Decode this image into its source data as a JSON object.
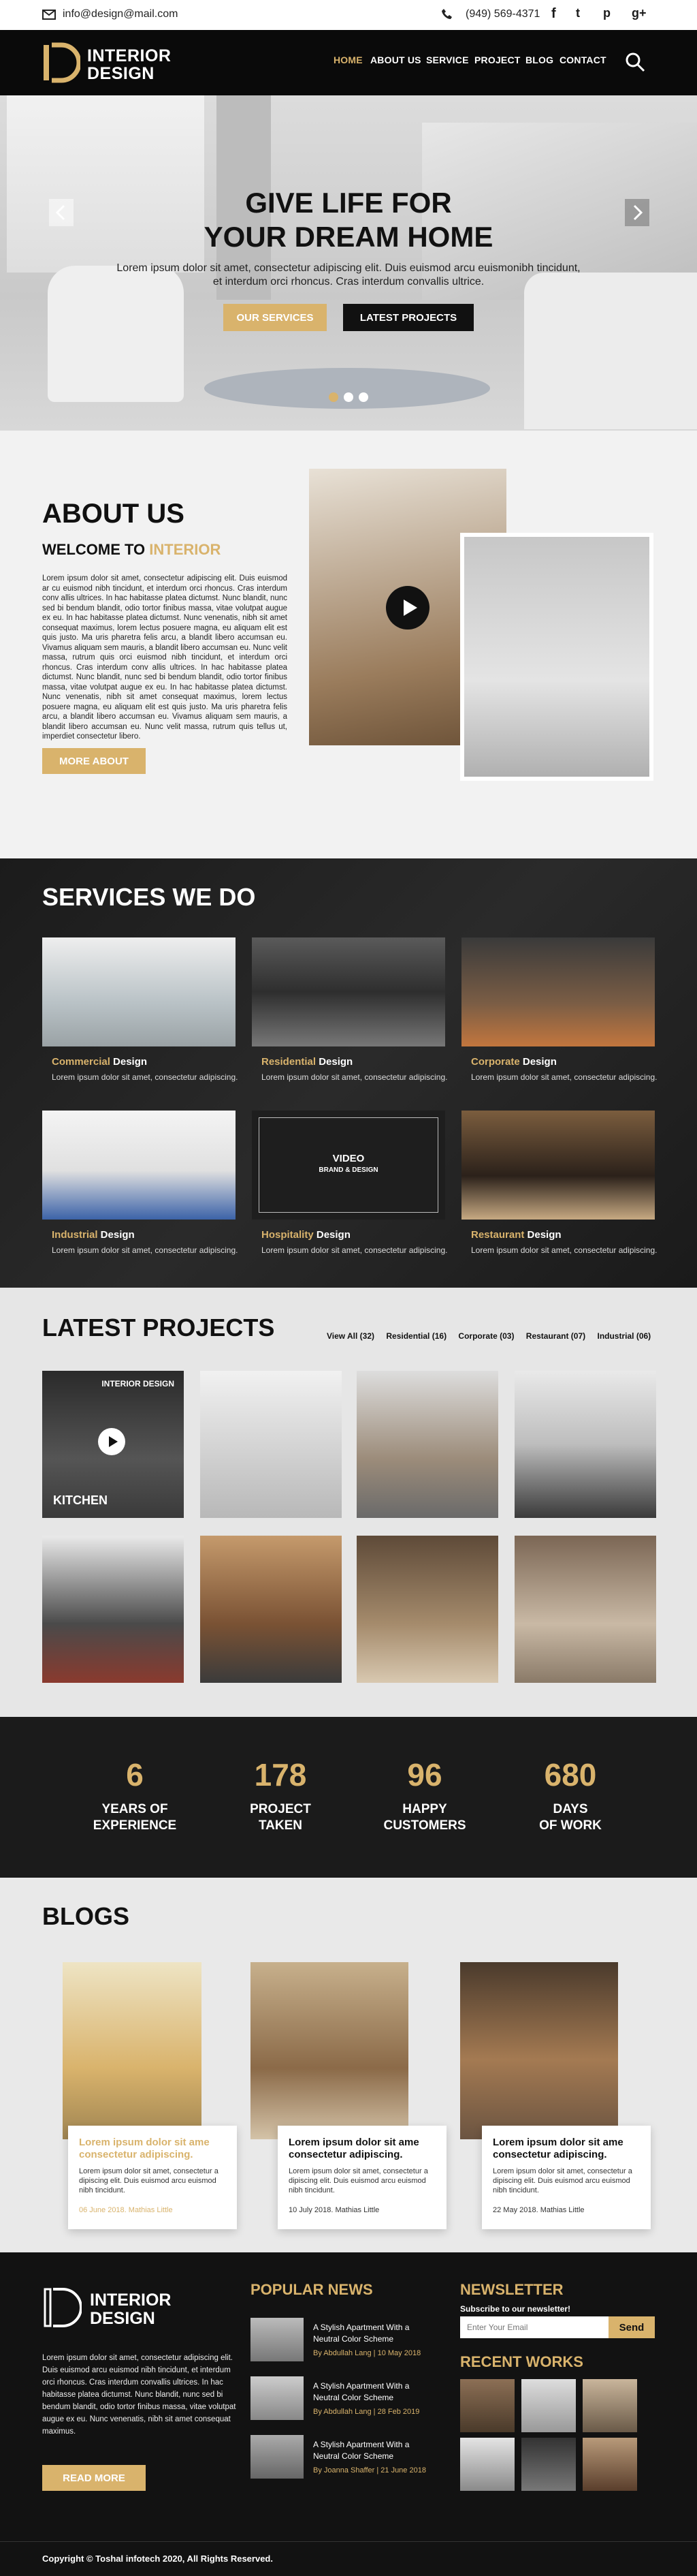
{
  "topbar": {
    "email": "info@design@mail.com",
    "phone": "(949) 569-4371",
    "social_icons": [
      "facebook-icon",
      "twitter-icon",
      "pinterest-icon",
      "google-plus-icon"
    ]
  },
  "nav": {
    "logo_line1": "INTERIOR",
    "logo_line2": "DESIGN",
    "items": [
      "HOME",
      "ABOUT US",
      "SERVICE",
      "PROJECT",
      "BLOG",
      "CONTACT"
    ],
    "active": "HOME"
  },
  "hero": {
    "title_line1": "GIVE LIFE FOR",
    "title_line2": "YOUR DREAM HOME",
    "subtitle": "Lorem ipsum dolor sit amet, consectetur adipiscing elit. Duis euismod arcu euismonibh tincidunt, et interdum orci rhoncus. Cras interdum convallis ultrice.",
    "btn_services": "OUR SERVICES",
    "btn_projects": "LATEST PROJECTS"
  },
  "about": {
    "heading": "ABOUT US",
    "welcome_prefix": "WELCOME TO ",
    "welcome_accent": "INTERIOR",
    "body": "Lorem ipsum dolor sit amet, consectetur adipiscing elit. Duis euismod ar cu euismod nibh tincidunt, et interdum orci rhoncus. Cras interdum conv allis ultrices. In hac habitasse platea dictumst. Nunc blandit, nunc sed bi bendum blandit, odio tortor finibus massa, vitae volutpat augue ex eu. In hac habitasse platea dictumst. Nunc venenatis, nibh sit amet consequat maximus, lorem lectus posuere magna, eu aliquam elit est quis justo. Ma uris pharetra felis arcu, a blandit libero accumsan eu. Vivamus aliquam sem mauris, a blandit libero accumsan eu. Nunc velit massa, rutrum quis orci euismod nibh tincidunt, et interdum orci rhoncus. Cras interdum conv allis ultrices. In hac habitasse platea dictumst. Nunc blandit, nunc sed bi bendum blandit, odio tortor finibus massa, vitae volutpat augue ex eu. In hac habitasse platea dictumst. Nunc venenatis, nibh sit amet consequat maximus, lorem lectus posuere magna, eu aliquam elit est quis justo. Ma uris pharetra felis arcu, a blandit libero accumsan eu. Vivamus aliquam sem mauris, a blandit libero accumsan eu. Nunc velit massa, rutrum quis tellus ut, imperdiet consectetur libero.",
    "btn_more": "MORE ABOUT"
  },
  "services": {
    "heading": "SERVICES WE DO",
    "desc": "Lorem ipsum dolor sit amet, consectetur adipiscing.",
    "video_label": "VIDEO",
    "video_sub": "BRAND & DESIGN",
    "items": [
      {
        "accent": "Commercial",
        "rest": " Design"
      },
      {
        "accent": "Residential",
        "rest": " Design"
      },
      {
        "accent": "Corporate",
        "rest": " Design"
      },
      {
        "accent": "Industrial",
        "rest": " Design"
      },
      {
        "accent": "Hospitality",
        "rest": " Design"
      },
      {
        "accent": "Restaurant",
        "rest": " Design"
      }
    ]
  },
  "projects": {
    "heading": "LATEST PROJECTS",
    "filters": [
      "View All (32)",
      "Residential (16)",
      "Corporate (03)",
      "Restaurant (07)",
      "Industrial (06)"
    ],
    "feature_tag": "INTERIOR DESIGN",
    "feature_label": "KITCHEN"
  },
  "stats": [
    {
      "num": "6",
      "l1": "YEARS OF",
      "l2": "EXPERIENCE"
    },
    {
      "num": "178",
      "l1": "PROJECT",
      "l2": "TAKEN"
    },
    {
      "num": "96",
      "l1": "HAPPY",
      "l2": "CUSTOMERS"
    },
    {
      "num": "680",
      "l1": "DAYS",
      "l2": "OF WORK"
    }
  ],
  "blogs": {
    "heading": "BLOGS",
    "posts": [
      {
        "title": "Lorem ipsum dolor sit ame consectetur adipiscing.",
        "excerpt": "Lorem ipsum dolor sit amet, consectetur a dipiscing elit. Duis euismod arcu euismod nibh tincidunt.",
        "meta": "06 June 2018. Mathias Little"
      },
      {
        "title": "Lorem ipsum dolor sit ame consectetur adipiscing.",
        "excerpt": "Lorem ipsum dolor sit amet, consectetur a dipiscing elit. Duis euismod arcu euismod nibh tincidunt.",
        "meta": "10 July 2018. Mathias Little"
      },
      {
        "title": "Lorem ipsum dolor sit ame consectetur adipiscing.",
        "excerpt": "Lorem ipsum dolor sit amet, consectetur a dipiscing elit. Duis euismod arcu euismod nibh tincidunt.",
        "meta": "22 May 2018. Mathias Little"
      }
    ]
  },
  "footer": {
    "about": "Lorem ipsum dolor sit amet, consectetur adipiscing elit. Duis euismod arcu euismod nibh tincidunt, et interdum orci rhoncus. Cras interdum convallis ultrices. In hac habitasse platea dictumst. Nunc blandit, nunc sed bi bendum blandit, odio tortor finibus massa, vitae volutpat augue ex eu. Nunc venenatis, nibh sit amet consequat maximus.",
    "btn_more": "READ MORE",
    "popular_heading": "POPULAR NEWS",
    "news": [
      {
        "title": "A Stylish Apartment With a Neutral Color Scheme",
        "meta": "By Abdullah Lang  |  10 May 2018"
      },
      {
        "title": "A Stylish Apartment With a Neutral Color Scheme",
        "meta": "By Abdullah Lang  |  28 Feb 2019"
      },
      {
        "title": "A Stylish Apartment With a Neutral Color Scheme",
        "meta": "By Joanna Shaffer  |  21 June 2018"
      }
    ],
    "newsletter_heading": "NEWSLETTER",
    "newsletter_sub": "Subscribe to our newsletter!",
    "email_placeholder": "Enter Your Email",
    "send": "Send",
    "recent_heading": "RECENT WORKS",
    "copyright": "Copyright © Toshal infotech 2020, All Rights Reserved."
  }
}
